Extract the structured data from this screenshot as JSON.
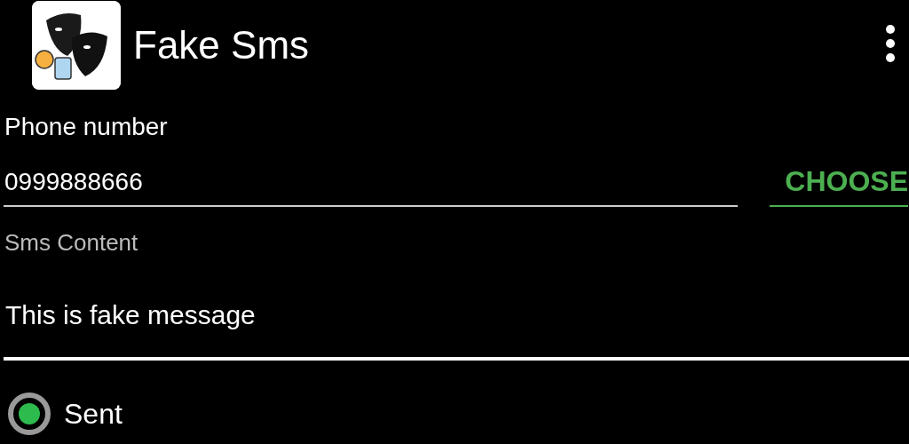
{
  "app_bar": {
    "title": "Fake Sms"
  },
  "phone": {
    "label": "Phone number",
    "value": "0999888666",
    "button": "CHOOSE"
  },
  "content": {
    "label": "Sms Content",
    "value": "This is fake message"
  },
  "options": [
    {
      "label": "Sent",
      "selected": true
    }
  ]
}
